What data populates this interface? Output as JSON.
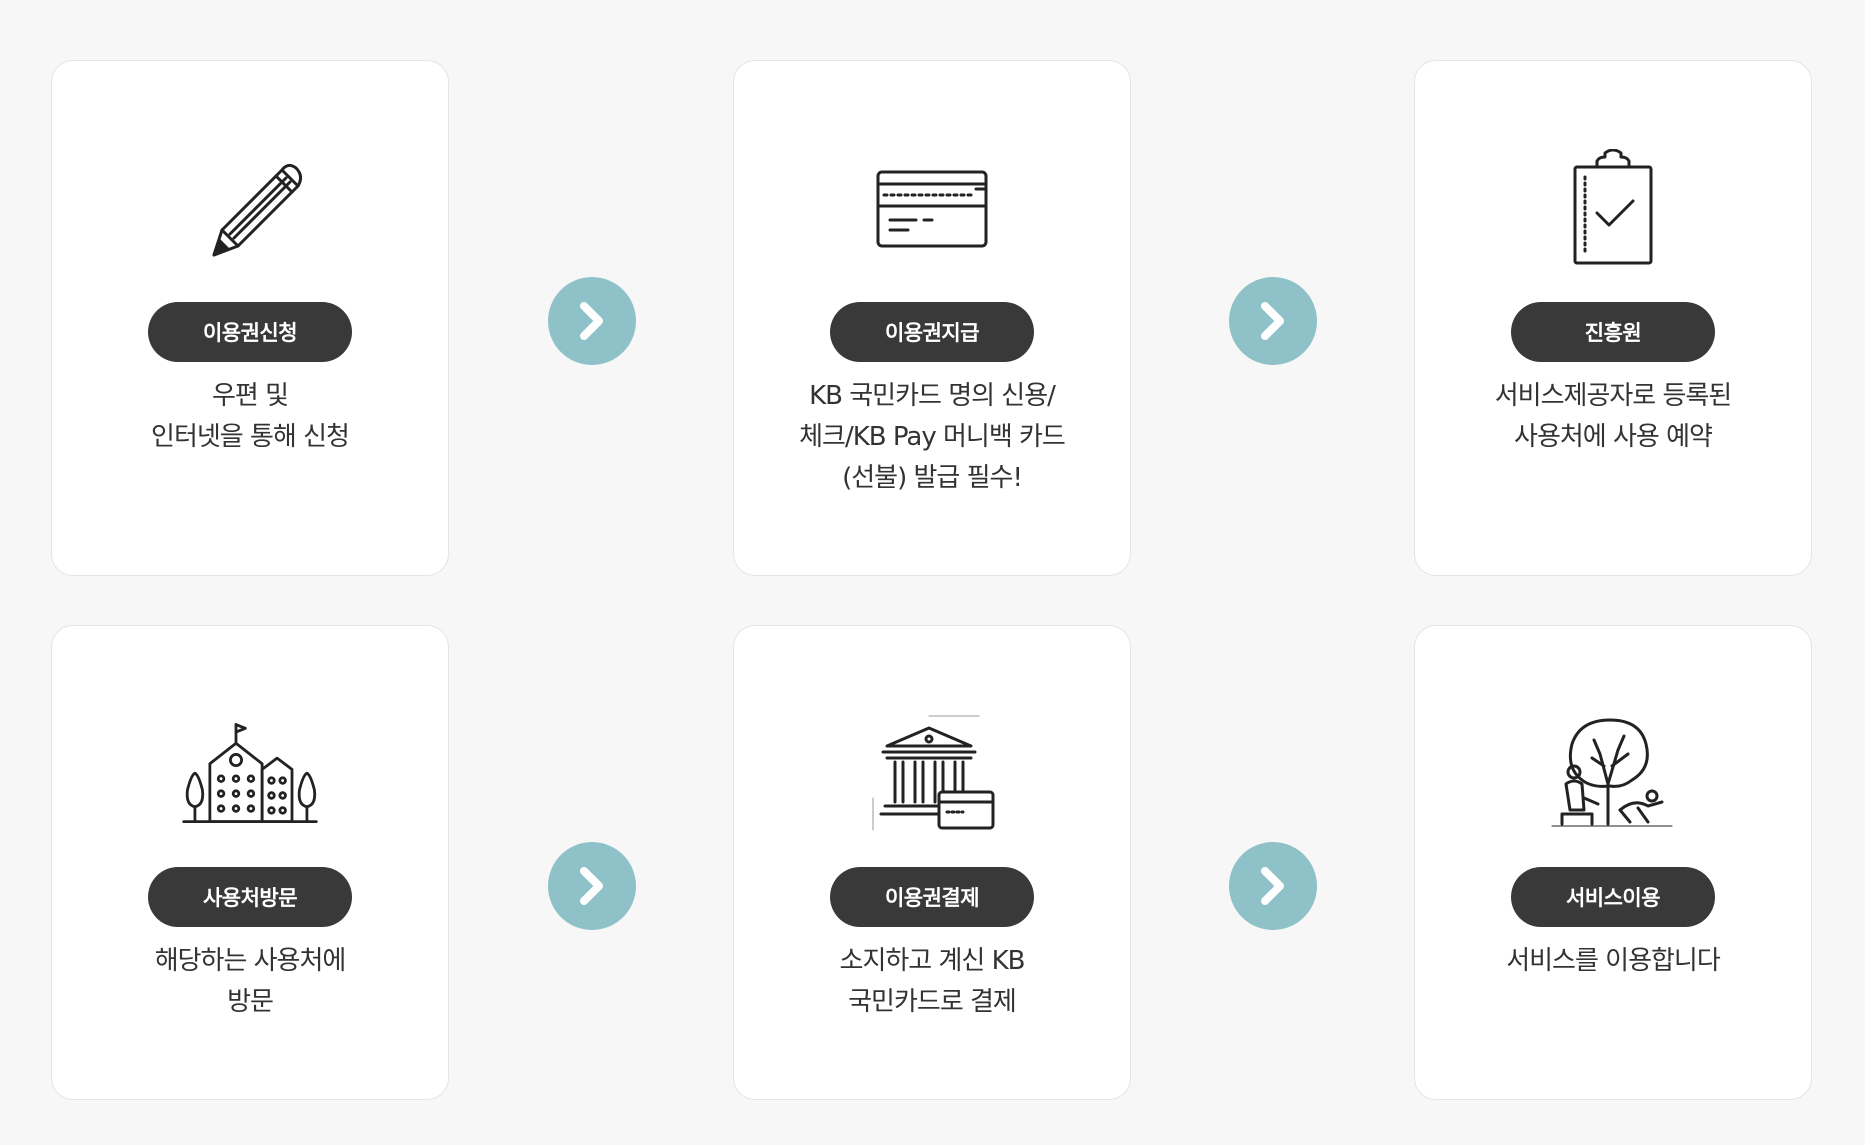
{
  "colors": {
    "background": "#f7f7f7",
    "card": "#ffffff",
    "pill": "#393939",
    "arrow": "#8fc2c8",
    "text": "#333333"
  },
  "steps": [
    {
      "icon": "pencil-icon",
      "label": "이용권신청",
      "desc": [
        "우편 및",
        "인터넷을 통해 신청"
      ]
    },
    {
      "icon": "credit-card-icon",
      "label": "이용권지급",
      "desc": [
        "KB 국민카드 명의 신용/",
        "체크/KB Pay 머니백 카드",
        "(선불) 발급 필수!"
      ]
    },
    {
      "icon": "clipboard-check-icon",
      "label": "진흥원",
      "desc": [
        "서비스제공자로 등록된",
        "사용처에 사용 예약"
      ]
    },
    {
      "icon": "school-building-icon",
      "label": "사용처방문",
      "desc": [
        "해당하는 사용처에",
        "방문"
      ]
    },
    {
      "icon": "bank-card-icon",
      "label": "이용권결제",
      "desc": [
        "소지하고 계신 KB",
        "국민카드로 결제"
      ]
    },
    {
      "icon": "tree-people-icon",
      "label": "서비스이용",
      "desc": [
        "서비스를 이용합니다"
      ]
    }
  ],
  "arrows": [
    {
      "icon": "chevron-right-icon"
    },
    {
      "icon": "chevron-right-icon"
    },
    {
      "icon": "chevron-right-icon"
    },
    {
      "icon": "chevron-right-icon"
    }
  ]
}
